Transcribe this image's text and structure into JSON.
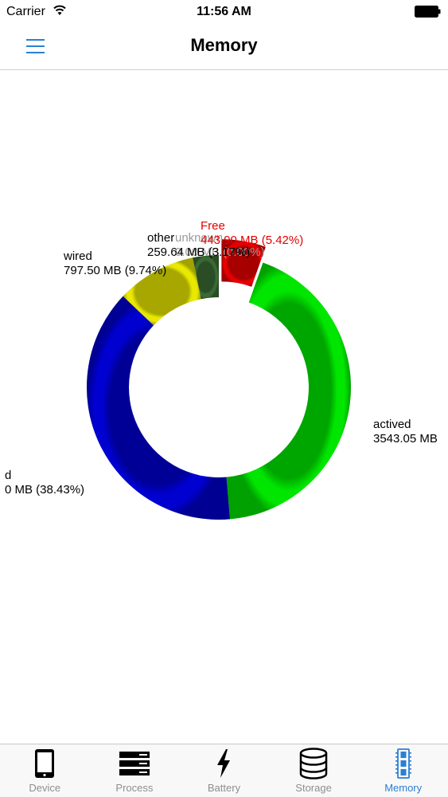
{
  "status_bar": {
    "carrier": "Carrier",
    "time": "11:56 AM"
  },
  "nav": {
    "title": "Memory"
  },
  "chart_data": {
    "type": "pie",
    "style": "donut",
    "slices": [
      {
        "name": "Free",
        "value_text": "443.90 MB (5.42%)",
        "percent": 5.42,
        "color": "#e60000",
        "label_color": "#e60000",
        "exploded": true
      },
      {
        "name": "actived",
        "value_text": "3543.05 MB",
        "percent": 43.24,
        "color": "#00e600",
        "label_color": "#000000"
      },
      {
        "name": "d",
        "value_text": "0 MB (38.43%)",
        "percent": 38.43,
        "color": "#0000d0",
        "label_color": "#000000"
      },
      {
        "name": "wired",
        "value_text": "797.50 MB (9.74%)",
        "percent": 9.74,
        "color": "#e8e800",
        "label_color": "#000000"
      },
      {
        "name": "other",
        "value_text": "259.64 MB (3.17%)",
        "percent": 3.17,
        "color": "#3a6b35",
        "label_color": "#000000"
      },
      {
        "name": "unknown",
        "value_text": "0.00 MB (0.00%)",
        "percent": 0.0,
        "color": "#999999",
        "label_color": "#9a9a9a"
      }
    ]
  },
  "tabs": [
    {
      "label": "Device",
      "icon": "phone-icon",
      "active": false
    },
    {
      "label": "Process",
      "icon": "server-icon",
      "active": false
    },
    {
      "label": "Battery",
      "icon": "bolt-icon",
      "active": false
    },
    {
      "label": "Storage",
      "icon": "database-icon",
      "active": false
    },
    {
      "label": "Memory",
      "icon": "memory-chip-icon",
      "active": true
    }
  ],
  "colors": {
    "accent": "#2a7fd4",
    "tab_inactive": "#8e8e8e"
  }
}
